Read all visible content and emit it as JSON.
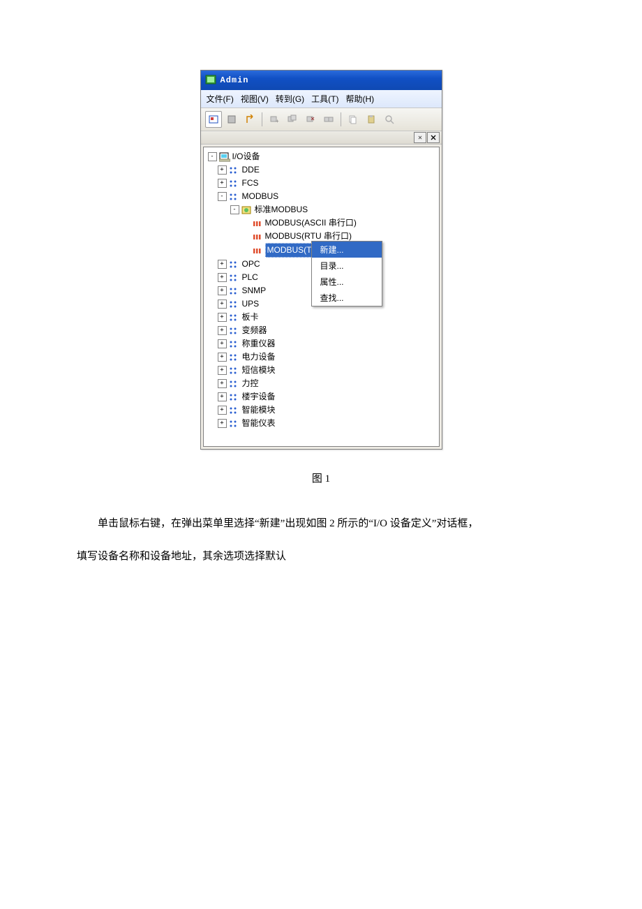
{
  "window": {
    "title": "Admin"
  },
  "menu": {
    "file": "文件(F)",
    "view": "视图(V)",
    "goto": "转到(G)",
    "tool": "工具(T)",
    "help": "帮助(H)"
  },
  "tree": {
    "root": "I/O设备",
    "dde": "DDE",
    "fcs": "FCS",
    "modbus": "MODBUS",
    "std_modbus": "标准MODBUS",
    "modbus_ascii": "MODBUS(ASCII 串行口)",
    "modbus_rtu": "MODBUS(RTU 串行口)",
    "modbus_tcp": "MODBUS(TCP)",
    "opc": "OPC",
    "plc": "PLC",
    "snmp": "SNMP",
    "ups": "UPS",
    "card": "板卡",
    "inverter": "变频器",
    "weigh": "称重仪器",
    "power": "电力设备",
    "sms": "短信模块",
    "force": "力控",
    "building": "楼宇设备",
    "smart_mod": "智能模块",
    "smart_inst": "智能仪表"
  },
  "context_menu": {
    "new": "新建...",
    "dir": "目录...",
    "prop": "属性...",
    "find": "查找..."
  },
  "caption": "图 1",
  "paragraph1": "单击鼠标右键，在弹出菜单里选择“新建”出现如图 2 所示的“I/O 设备定义”对话框，",
  "paragraph2": "填写设备名称和设备地址，其余选项选择默认"
}
